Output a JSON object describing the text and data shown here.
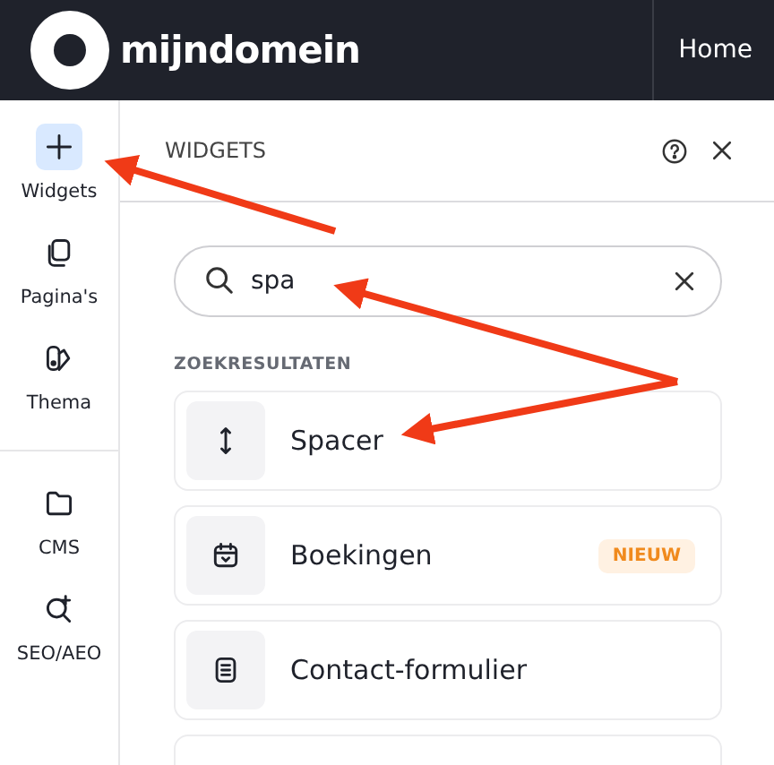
{
  "header": {
    "brand": "mijndomein",
    "nav_button": "Home"
  },
  "sidebar": {
    "items": [
      {
        "label": "Widgets",
        "selected": true
      },
      {
        "label": "Pagina's",
        "selected": false
      },
      {
        "label": "Thema",
        "selected": false
      }
    ],
    "items_bottom": [
      {
        "label": "CMS",
        "selected": false
      },
      {
        "label": "SEO/AEO",
        "selected": false
      }
    ]
  },
  "panel": {
    "title": "WIDGETS",
    "search": {
      "value": "spa"
    },
    "section_label": "ZOEKRESULTATEN",
    "results": [
      {
        "name": "Spacer"
      },
      {
        "name": "Boekingen",
        "badge": "NIEUW"
      },
      {
        "name": "Contact-formulier"
      }
    ]
  }
}
